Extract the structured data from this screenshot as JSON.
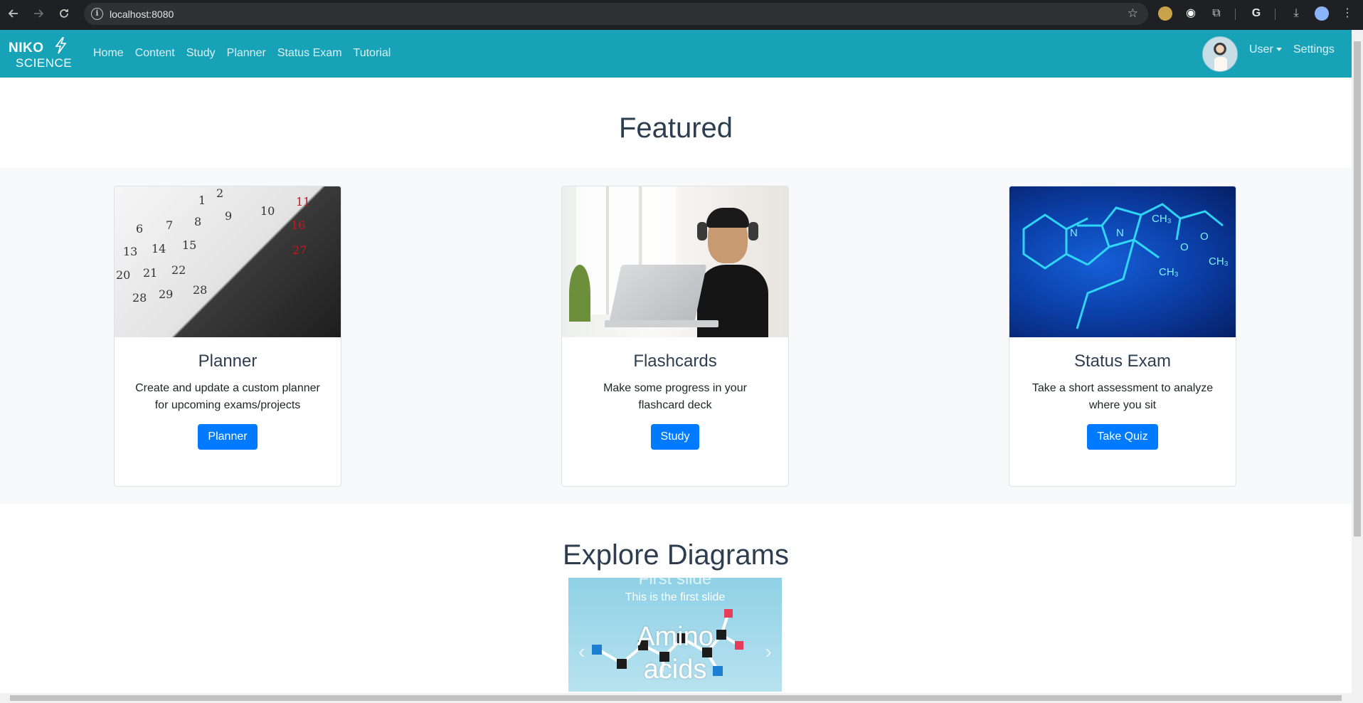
{
  "browser": {
    "url": "localhost:8080"
  },
  "navbar": {
    "brand_line1": "NIKO",
    "brand_line2": "SCIENCE",
    "links": [
      "Home",
      "Content",
      "Study",
      "Planner",
      "Status Exam",
      "Tutorial"
    ],
    "user_label": "User",
    "settings_label": "Settings"
  },
  "featured": {
    "title": "Featured",
    "cards": [
      {
        "title": "Planner",
        "text": "Create and update a custom planner for upcoming exams/projects",
        "button": "Planner"
      },
      {
        "title": "Flashcards",
        "text": "Make some progress in your flashcard deck",
        "button": "Study"
      },
      {
        "title": "Status Exam",
        "text": "Take a short assessment to analyze where you sit",
        "button": "Take Quiz"
      }
    ]
  },
  "diagrams": {
    "title": "Explore Diagrams",
    "slide_heading": "First slide",
    "slide_caption": "This is the first slide",
    "slide_image_text": "Amino acids"
  },
  "colors": {
    "navbar": "#17a2b8",
    "primary_button": "#007bff",
    "band": "#f8f9fa"
  }
}
